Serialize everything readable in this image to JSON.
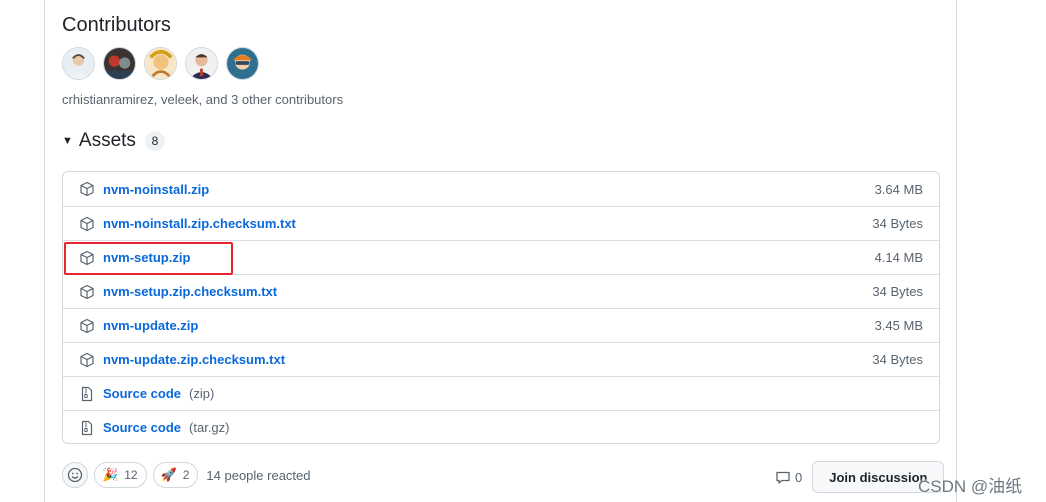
{
  "contributors": {
    "title": "Contributors",
    "summary": "crhistianramirez, veleek, and 3 other contributors",
    "avatars": [
      "avatar-1",
      "avatar-2",
      "avatar-3",
      "avatar-4",
      "avatar-5"
    ]
  },
  "assets": {
    "title": "Assets",
    "count": "8",
    "items": [
      {
        "name": "nvm-noinstall.zip",
        "size": "3.64 MB",
        "icon": "package-icon"
      },
      {
        "name": "nvm-noinstall.zip.checksum.txt",
        "size": "34 Bytes",
        "icon": "package-icon"
      },
      {
        "name": "nvm-setup.zip",
        "size": "4.14 MB",
        "icon": "package-icon"
      },
      {
        "name": "nvm-setup.zip.checksum.txt",
        "size": "34 Bytes",
        "icon": "package-icon"
      },
      {
        "name": "nvm-update.zip",
        "size": "3.45 MB",
        "icon": "package-icon"
      },
      {
        "name": "nvm-update.zip.checksum.txt",
        "size": "34 Bytes",
        "icon": "package-icon"
      },
      {
        "name": "Source code",
        "suffix": "(zip)",
        "icon": "file-zip-icon"
      },
      {
        "name": "Source code",
        "suffix": "(tar.gz)",
        "icon": "file-zip-icon"
      }
    ]
  },
  "reactions": {
    "items": [
      {
        "emoji": "🎉",
        "count": "12"
      },
      {
        "emoji": "🚀",
        "count": "2"
      }
    ],
    "summary": "14 people reacted"
  },
  "discussion": {
    "comment_count": "0",
    "join_label": "Join discussion"
  },
  "watermark": "CSDN @油纸",
  "colors": {
    "link": "#0969da",
    "muted": "#59636e",
    "border": "#d0d7de",
    "highlight": "#e8242c"
  }
}
